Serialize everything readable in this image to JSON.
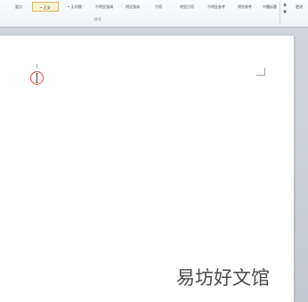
{
  "ribbon": {
    "styles": [
      {
        "label": "要点",
        "selected": false
      },
      {
        "label": "• 正文",
        "selected": true
      },
      {
        "label": "• 无间隔",
        "selected": false
      },
      {
        "label": "不明显强调",
        "selected": false
      },
      {
        "label": "明显强调",
        "selected": false
      },
      {
        "label": "引用",
        "selected": false
      },
      {
        "label": "明显引用",
        "selected": false
      },
      {
        "label": "不明显参考",
        "selected": false
      },
      {
        "label": "明显参考",
        "selected": false
      },
      {
        "label": "书籍标题",
        "selected": false
      }
    ],
    "group_label": "样式",
    "scroll_up": "▲",
    "scroll_more": "▼",
    "extra_label": "更改"
  },
  "document": {
    "watermark": "易坊好文馆"
  },
  "icons": {
    "cursor": "i-beam-cursor-icon",
    "margin_mark": "corner-mark-icon"
  },
  "colors": {
    "selected_style_border": "#e2b85a",
    "cursor_highlight": "#e04848"
  }
}
